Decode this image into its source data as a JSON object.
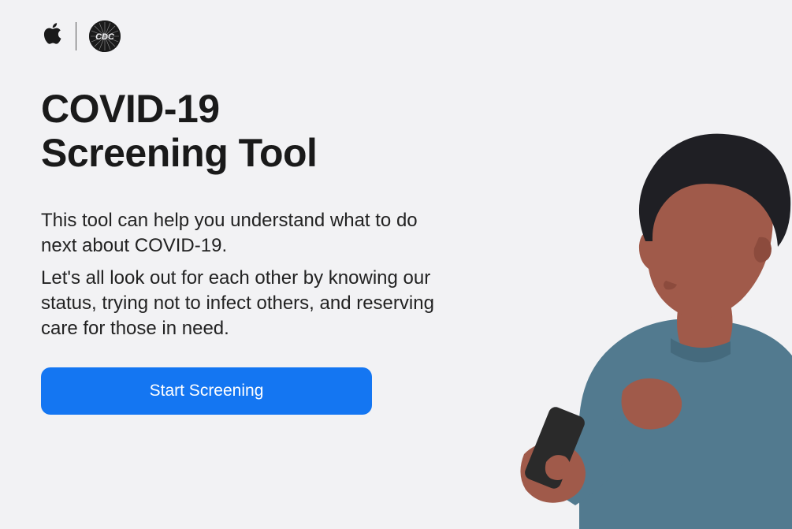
{
  "header": {
    "apple_icon": "apple-logo",
    "cdc_icon": "cdc-logo",
    "cdc_label": "CDC"
  },
  "main": {
    "title_line1": "COVID-19",
    "title_line2": "Screening Tool",
    "paragraph1": "This tool can help you understand what to do next about COVID-19.",
    "paragraph2": "Let's all look out for each other by knowing our status, trying not to infect others, and reserving care for those in need."
  },
  "cta": {
    "label": "Start Screening"
  },
  "illustration": {
    "description": "person-holding-phone"
  },
  "colors": {
    "background": "#f2f2f4",
    "text": "#1a1a1a",
    "accent": "#1476f2",
    "skin": "#a05a4a",
    "hair": "#1f1f24",
    "shirt": "#527a8f",
    "phone": "#2a2a2a"
  }
}
